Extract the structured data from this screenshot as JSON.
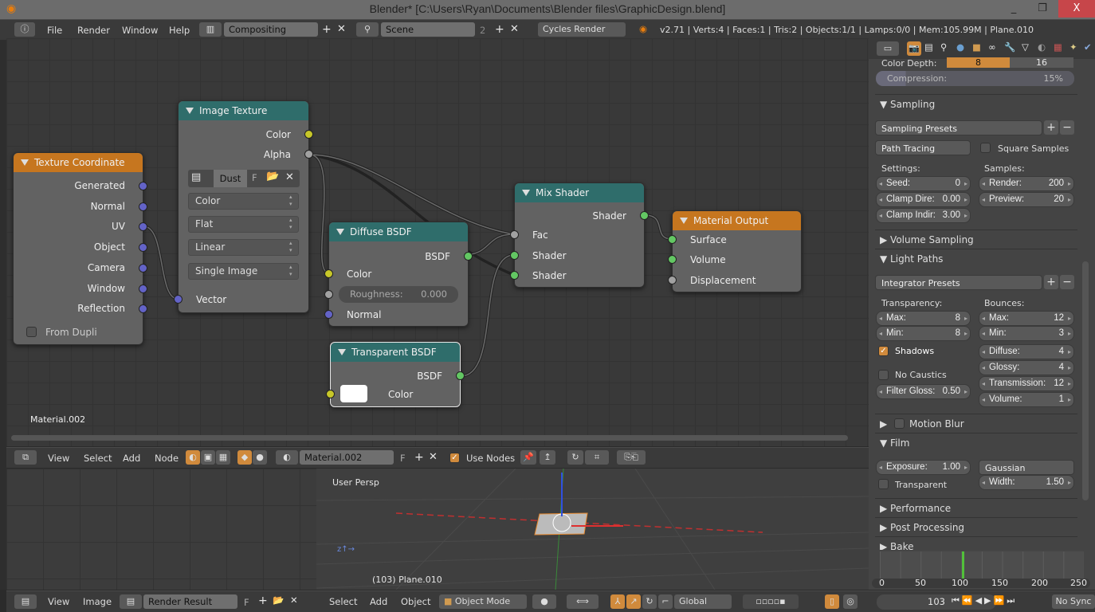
{
  "window": {
    "title": "Blender* [C:\\Users\\Ryan\\Documents\\Blender files\\GraphicDesign.blend]",
    "minimize": "_",
    "restore": "❐",
    "close": "X"
  },
  "topbar": {
    "menus": [
      "File",
      "Render",
      "Window",
      "Help"
    ],
    "screen_layout": "Compositing",
    "scene": "Scene",
    "scene_users": "2",
    "render_engine": "Cycles Render",
    "stats": "v2.71 | Verts:4 | Faces:1 | Tris:2 | Objects:1/1 | Lamps:0/0 | Mem:105.99M | Plane.010"
  },
  "node_editor": {
    "material_label": "Material.002",
    "nodes": {
      "texture_coordinate": {
        "title": "Texture Coordinate",
        "outputs": [
          "Generated",
          "Normal",
          "UV",
          "Object",
          "Camera",
          "Window",
          "Reflection"
        ],
        "from_dupli": "From Dupli"
      },
      "image_texture": {
        "title": "Image Texture",
        "outputs": [
          "Color",
          "Alpha"
        ],
        "image": "Dust",
        "fake_user": "F",
        "color_space": "Color",
        "projection": "Flat",
        "interpolation": "Linear",
        "source": "Single Image",
        "input": "Vector"
      },
      "diffuse_bsdf": {
        "title": "Diffuse BSDF",
        "output": "BSDF",
        "inputs": [
          "Color",
          "Normal"
        ],
        "roughness_label": "Roughness:",
        "roughness": "0.000"
      },
      "transparent_bsdf": {
        "title": "Transparent BSDF",
        "output": "BSDF",
        "input": "Color",
        "color": "#ffffff"
      },
      "mix_shader": {
        "title": "Mix Shader",
        "output": "Shader",
        "inputs": [
          "Fac",
          "Shader",
          "Shader"
        ]
      },
      "material_output": {
        "title": "Material Output",
        "inputs": [
          "Surface",
          "Volume",
          "Displacement"
        ]
      }
    },
    "header": {
      "menus": [
        "View",
        "Select",
        "Add",
        "Node"
      ],
      "material": "Material.002",
      "fake_user": "F",
      "use_nodes": "Use Nodes",
      "use_nodes_checked": true
    }
  },
  "properties": {
    "color_depth_label": "Color Depth:",
    "color_depth_options": [
      "8",
      "16"
    ],
    "color_depth_selected": "8",
    "compression_label": "Compression:",
    "compression": "15%",
    "sampling": {
      "title": "Sampling",
      "presets": "Sampling Presets",
      "integrator": "Path Tracing",
      "square_samples": "Square Samples",
      "settings_label": "Settings:",
      "samples_label": "Samples:",
      "seed_k": "Seed:",
      "seed": "0",
      "clamp_direct_k": "Clamp Dire:",
      "clamp_direct": "0.00",
      "clamp_indirect_k": "Clamp Indir:",
      "clamp_indirect": "3.00",
      "render_k": "Render:",
      "render": "200",
      "preview_k": "Preview:",
      "preview": "20"
    },
    "volume_sampling": "Volume Sampling",
    "light_paths": {
      "title": "Light Paths",
      "presets": "Integrator Presets",
      "transparency_label": "Transparency:",
      "bounces_label": "Bounces:",
      "t_max_k": "Max:",
      "t_max": "8",
      "t_min_k": "Min:",
      "t_min": "8",
      "shadows": "Shadows",
      "shadows_checked": true,
      "no_caustics": "No Caustics",
      "filter_gloss_k": "Filter Gloss:",
      "filter_gloss": "0.50",
      "b_max_k": "Max:",
      "b_max": "12",
      "b_min_k": "Min:",
      "b_min": "3",
      "diffuse_k": "Diffuse:",
      "diffuse": "4",
      "glossy_k": "Glossy:",
      "glossy": "4",
      "transmission_k": "Transmission:",
      "transmission": "12",
      "volume_k": "Volume:",
      "volume": "1"
    },
    "motion_blur": "Motion Blur",
    "film": {
      "title": "Film",
      "exposure_k": "Exposure:",
      "exposure": "1.00",
      "transparent": "Transparent",
      "filter": "Gaussian",
      "width_k": "Width:",
      "width": "1.50"
    },
    "performance": "Performance",
    "post_processing": "Post Processing",
    "bake": "Bake"
  },
  "timeline": {
    "ticks": [
      "0",
      "50",
      "100",
      "150",
      "200",
      "250"
    ],
    "current_frame": "103",
    "sync": "No Sync"
  },
  "image_editor": {
    "menus": [
      "View",
      "Image"
    ],
    "image": "Render Result",
    "fake_user": "F"
  },
  "viewport": {
    "label": "User Persp",
    "object_label": "(103) Plane.010",
    "menus": [
      "Select",
      "Add",
      "Object"
    ],
    "mode": "Object Mode",
    "orientation": "Global"
  },
  "colors": {
    "accent": "#d08a3c",
    "node_teal": "#2f6d6b",
    "node_orange": "#c6761f",
    "socket_color": "#c7c729",
    "socket_shader": "#63c763",
    "socket_vector": "#6363c7",
    "frame_marker": "#52c03a"
  }
}
